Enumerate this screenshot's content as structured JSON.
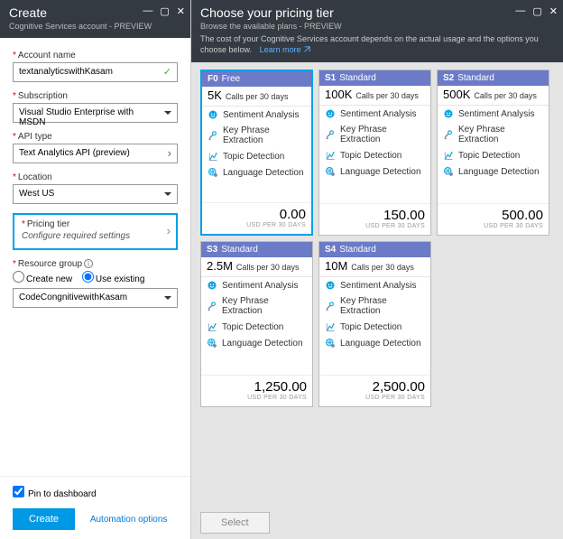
{
  "left": {
    "title": "Create",
    "subtitle": "Cognitive Services account - PREVIEW",
    "account_label": "Account name",
    "account_value": "textanalyticswithKasam",
    "subscription_label": "Subscription",
    "subscription_value": "Visual Studio Enterprise with MSDN",
    "apitype_label": "API type",
    "apitype_value": "Text Analytics API (preview)",
    "location_label": "Location",
    "location_value": "West US",
    "pricing_label": "Pricing tier",
    "pricing_value": "Configure required settings",
    "rg_label": "Resource group",
    "rg_create": "Create new",
    "rg_existing": "Use existing",
    "rg_value": "CodeCongnitivewithKasam",
    "pin_label": "Pin to dashboard",
    "create_btn": "Create",
    "auto_link": "Automation options"
  },
  "right": {
    "title": "Choose your pricing tier",
    "subtitle": "Browse the available plans - PREVIEW",
    "desc": "The cost of your Cognitive Services account depends on the actual usage and the options you choose below.",
    "learn": "Learn more",
    "calls_lbl": "Calls per 30 days",
    "price_unit": "USD PER 30 DAYS",
    "select_btn": "Select",
    "features": [
      "Sentiment Analysis",
      "Key Phrase Extraction",
      "Topic Detection",
      "Language Detection"
    ],
    "tiers": [
      {
        "code": "F0",
        "name": "Free",
        "calls": "5K",
        "price": "0.00"
      },
      {
        "code": "S1",
        "name": "Standard",
        "calls": "100K",
        "price": "150.00"
      },
      {
        "code": "S2",
        "name": "Standard",
        "calls": "500K",
        "price": "500.00"
      },
      {
        "code": "S3",
        "name": "Standard",
        "calls": "2.5M",
        "price": "1,250.00"
      },
      {
        "code": "S4",
        "name": "Standard",
        "calls": "10M",
        "price": "2,500.00"
      }
    ]
  }
}
